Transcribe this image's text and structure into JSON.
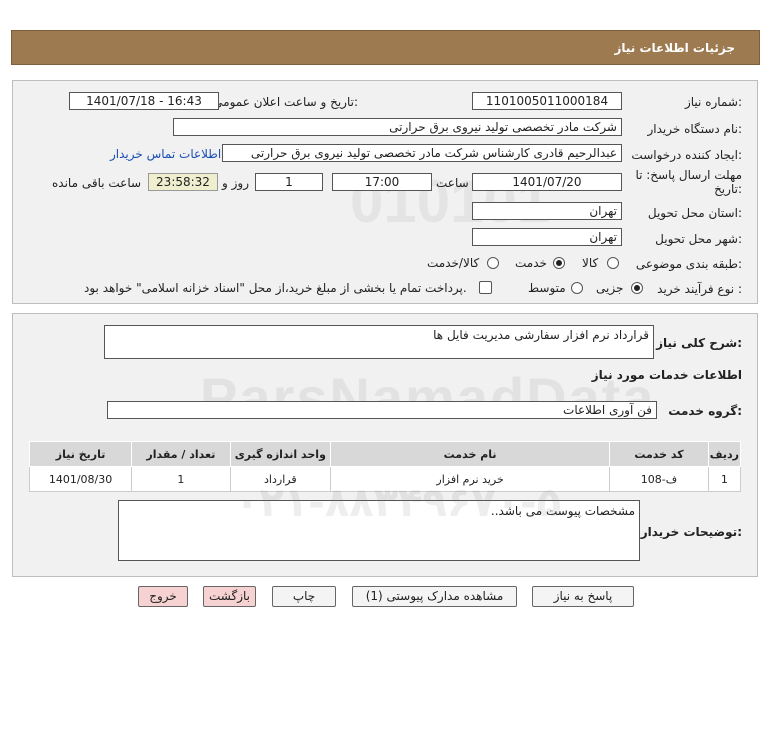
{
  "header": {
    "title": "جزئیات اطلاعات نیاز"
  },
  "form": {
    "need_number_label": "شماره نیاز:",
    "need_number": "1101005011000184",
    "announce_label": "تاریخ و ساعت اعلان عمومی:",
    "announce_value": "1401/07/18 - 16:43",
    "buyer_org_label": "نام دستگاه خریدار:",
    "buyer_org": "شرکت مادر تخصصی تولید نیروی برق حرارتی",
    "creator_label": "ایجاد کننده درخواست:",
    "creator": "عبدالرحیم قادری کارشناس شرکت مادر تخصصی تولید نیروی برق حرارتی",
    "contact_link": "اطلاعات تماس خریدار",
    "deadline_label_1": "مهلت ارسال پاسخ: تا",
    "deadline_label_2": "تاریخ:",
    "deadline_date": "1401/07/20",
    "time_label": "ساعت",
    "deadline_time": "17:00",
    "days_value": "1",
    "days_label": "روز و",
    "remaining_time": "23:58:32",
    "remaining_label": "ساعت باقی مانده",
    "province_label": "استان محل تحویل:",
    "province": "تهران",
    "city_label": "شهر محل تحویل:",
    "city": "تهران",
    "category_label": "طبقه بندی موضوعی:",
    "category_options": [
      "کالا",
      "خدمت",
      "کالا/خدمت"
    ],
    "category_selected": "خدمت",
    "process_label": "نوع فرآیند خرید :",
    "process_options": [
      "جزیی",
      "متوسط"
    ],
    "process_selected": "جزیی",
    "payment_note": "پرداخت تمام یا بخشی از مبلغ خرید،از محل \"اسناد خزانه اسلامی\" خواهد بود."
  },
  "details": {
    "summary_label": "شرح کلی نیاز:",
    "summary": "قرارداد نرم افزار سفارشی مدیریت فایل ها",
    "services_heading": "اطلاعات خدمات مورد نیاز",
    "service_group_label": "گروه خدمت:",
    "service_group": "فن آوری اطلاعات",
    "table": {
      "headers": [
        "ردیف",
        "کد خدمت",
        "نام خدمت",
        "واحد اندازه گیری",
        "تعداد / مقدار",
        "تاریخ نیاز"
      ],
      "rows": [
        [
          "1",
          "ف-108",
          "خرید نرم افزار",
          "قرارداد",
          "1",
          "1401/08/30"
        ]
      ]
    },
    "buyer_notes_label": "توضیحات خریدار:",
    "buyer_notes": "مشخصات پیوست می باشد.."
  },
  "buttons": {
    "reply": "پاسخ به نیاز",
    "view_docs": "مشاهده مدارک پیوستی (1)",
    "print": "چاپ",
    "back": "بازگشت",
    "exit": "خروج"
  },
  "watermark": {
    "brand": "ParsNamadData",
    "digits": "010101",
    "phone": "۰۲۱-۸۸۳۴۹۶۷۰-۵"
  }
}
